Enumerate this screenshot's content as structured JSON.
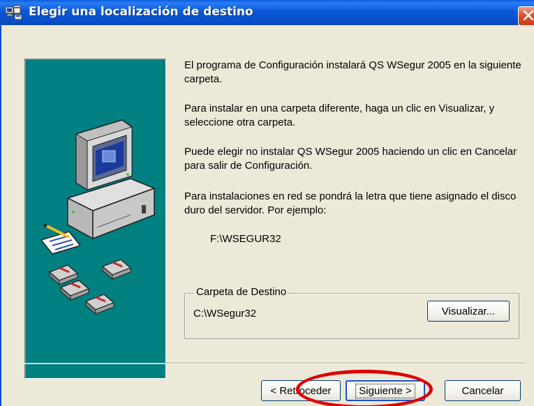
{
  "window": {
    "title": "Elegir una localización de destino"
  },
  "content": {
    "paragraphs": [
      "El programa de Configuración instalará QS WSegur 2005 en la siguiente carpeta.",
      "Para instalar en una carpeta diferente, haga un clic en Visualizar, y seleccione otra carpeta.",
      "Puede elegir no instalar QS WSegur 2005 haciendo un clic en Cancelar para salir de Configuración.",
      "Para instalaciones en red se pondrá la letra que tiene asignado el disco duro del servidor. Por ejemplo:"
    ],
    "example_path": "F:\\WSEGUR32"
  },
  "destination": {
    "group_label": "Carpeta de Destino",
    "path": "C:\\WSegur32",
    "browse_label": "Visualizar..."
  },
  "buttons": {
    "back_label": "< Retroceder",
    "next_label": "Siguiente >",
    "cancel_label": "Cancelar"
  },
  "icons": {
    "title": "setup-app-icon",
    "close": "close-x-icon",
    "illustration": "computer-with-disks-illustration"
  },
  "colors": {
    "titlebar": "#0a58d8",
    "client_bg": "#ece9d8",
    "art_panel": "#008080",
    "highlight_ring": "#e00000"
  }
}
